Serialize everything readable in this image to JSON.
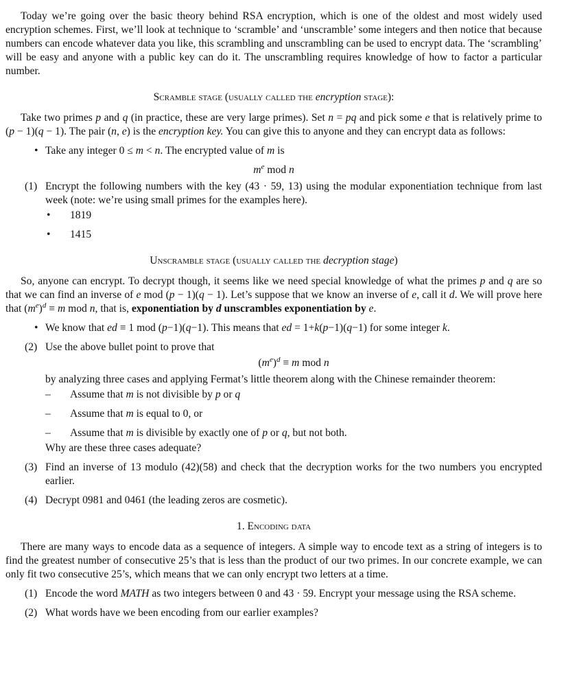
{
  "blocks": [
    {
      "type": "p",
      "segs": [
        {
          "t": "Today we’re going over the basic theory behind RSA encryption, which is one of the oldest and most widely used encryption schemes. First, we’ll look at technique to ‘scramble’ and ‘unscramble’ some integers and then notice that because numbers can encode whatever data you like, this scrambling and unscrambling can be used to encrypt data. The ‘scrambling’ will be easy and anyone with a public key can do it. The unscrambling requires knowledge of how to factor a particular number."
        }
      ]
    },
    {
      "type": "h",
      "segs": [
        {
          "t": "Scramble stage (usually called the ",
          "s": "sc"
        },
        {
          "t": "encryption",
          "s": "i"
        },
        {
          "t": " stage):",
          "s": "sc"
        }
      ]
    },
    {
      "type": "p",
      "segs": [
        {
          "t": "Take two primes "
        },
        {
          "t": "p",
          "s": "i"
        },
        {
          "t": " and "
        },
        {
          "t": "q",
          "s": "i"
        },
        {
          "t": " (in practice, these are very large primes). Set "
        },
        {
          "t": "n",
          "s": "i"
        },
        {
          "t": " = "
        },
        {
          "t": "pq",
          "s": "i"
        },
        {
          "t": " and pick some "
        },
        {
          "t": "e",
          "s": "i"
        },
        {
          "t": " that is relatively prime to ("
        },
        {
          "t": "p",
          "s": "i"
        },
        {
          "t": " − 1)("
        },
        {
          "t": "q",
          "s": "i"
        },
        {
          "t": " − 1). The pair ("
        },
        {
          "t": "n",
          "s": "i"
        },
        {
          "t": ", "
        },
        {
          "t": "e",
          "s": "i"
        },
        {
          "t": ") is the "
        },
        {
          "t": "encryption key.",
          "s": "i"
        },
        {
          "t": " You can give this to anyone and they can encrypt data as follows:"
        }
      ]
    },
    {
      "type": "list",
      "items": [
        {
          "label": "•",
          "kind": "bullet",
          "segs": [
            {
              "t": "Take any integer 0 ≤ "
            },
            {
              "t": "m",
              "s": "i"
            },
            {
              "t": " < "
            },
            {
              "t": "n",
              "s": "i"
            },
            {
              "t": ". The encrypted value of "
            },
            {
              "t": "m",
              "s": "i"
            },
            {
              "t": " is"
            }
          ]
        }
      ]
    },
    {
      "type": "display",
      "segs": [
        {
          "t": "m",
          "s": "i"
        },
        {
          "t": "e",
          "s": "sup"
        },
        {
          "t": "    mod "
        },
        {
          "t": "n",
          "s": "i"
        }
      ]
    },
    {
      "type": "list",
      "items": [
        {
          "label": "(1)",
          "kind": "enum",
          "segs": [
            {
              "t": "Encrypt the following numbers with the key (43 · 59, 13) using the modular exponentiation technique from last week (note: we’re using small primes for the examples here)."
            }
          ],
          "children": [
            {
              "label": "•",
              "kind": "bullet",
              "segs": [
                {
                  "t": "1819"
                }
              ]
            },
            {
              "label": "•",
              "kind": "bullet",
              "segs": [
                {
                  "t": "1415"
                }
              ]
            }
          ]
        }
      ]
    },
    {
      "type": "h",
      "segs": [
        {
          "t": "Unscramble stage (usually called the ",
          "s": "sc"
        },
        {
          "t": "decryption stage",
          "s": "i"
        },
        {
          "t": ")"
        }
      ]
    },
    {
      "type": "p",
      "segs": [
        {
          "t": "So, anyone can encrypt. To decrypt though, it seems like we need special knowledge of what the primes "
        },
        {
          "t": "p",
          "s": "i"
        },
        {
          "t": " and "
        },
        {
          "t": "q",
          "s": "i"
        },
        {
          "t": " are so that we can find an inverse of "
        },
        {
          "t": "e",
          "s": "i"
        },
        {
          "t": " mod ("
        },
        {
          "t": "p",
          "s": "i"
        },
        {
          "t": " − 1)("
        },
        {
          "t": "q",
          "s": "i"
        },
        {
          "t": " − 1). Let’s suppose that we know an inverse of "
        },
        {
          "t": "e",
          "s": "i"
        },
        {
          "t": ", call it "
        },
        {
          "t": "d",
          "s": "i"
        },
        {
          "t": ". We will prove here that ("
        },
        {
          "t": "m",
          "s": "i"
        },
        {
          "t": "e",
          "s": "sup"
        },
        {
          "t": ")"
        },
        {
          "t": "d",
          "s": "sup"
        },
        {
          "t": " ≡ "
        },
        {
          "t": "m",
          "s": "i"
        },
        {
          "t": "  mod "
        },
        {
          "t": "n",
          "s": "i"
        },
        {
          "t": ", that is, "
        },
        {
          "t": "exponentiation by ",
          "s": "b"
        },
        {
          "t": "d",
          "s": "bi"
        },
        {
          "t": " unscrambles exponentiation by ",
          "s": "b"
        },
        {
          "t": "e",
          "s": "i"
        },
        {
          "t": "."
        }
      ]
    },
    {
      "type": "list",
      "items": [
        {
          "label": "•",
          "kind": "bullet",
          "segs": [
            {
              "t": "We know that "
            },
            {
              "t": "ed",
              "s": "i"
            },
            {
              "t": " ≡ 1  mod ("
            },
            {
              "t": "p",
              "s": "i"
            },
            {
              "t": "−1)("
            },
            {
              "t": "q",
              "s": "i"
            },
            {
              "t": "−1). This means that "
            },
            {
              "t": "ed",
              "s": "i"
            },
            {
              "t": " = 1+"
            },
            {
              "t": "k",
              "s": "i"
            },
            {
              "t": "("
            },
            {
              "t": "p",
              "s": "i"
            },
            {
              "t": "−1)("
            },
            {
              "t": "q",
              "s": "i"
            },
            {
              "t": "−1) for some integer "
            },
            {
              "t": "k",
              "s": "i"
            },
            {
              "t": "."
            }
          ]
        }
      ]
    },
    {
      "type": "list",
      "items": [
        {
          "label": "(2)",
          "kind": "enum",
          "segs": [
            {
              "t": "Use the above bullet point to prove that"
            }
          ],
          "display": [
            {
              "t": "("
            },
            {
              "t": "m",
              "s": "i"
            },
            {
              "t": "e",
              "s": "sup"
            },
            {
              "t": ")"
            },
            {
              "t": "d",
              "s": "sup"
            },
            {
              "t": " ≡ "
            },
            {
              "t": "m",
              "s": "i"
            },
            {
              "t": "    mod "
            },
            {
              "t": "n",
              "s": "i"
            }
          ],
          "after": [
            {
              "t": "by analyzing three cases and applying Fermat’s little theorem along with the Chinese remainder theorem:"
            }
          ],
          "children": [
            {
              "label": "–",
              "kind": "dash",
              "segs": [
                {
                  "t": "Assume that "
                },
                {
                  "t": "m",
                  "s": "i"
                },
                {
                  "t": " is not divisible by "
                },
                {
                  "t": "p",
                  "s": "i"
                },
                {
                  "t": " or "
                },
                {
                  "t": "q",
                  "s": "i"
                }
              ]
            },
            {
              "label": "–",
              "kind": "dash",
              "segs": [
                {
                  "t": "Assume that "
                },
                {
                  "t": "m",
                  "s": "i"
                },
                {
                  "t": " is equal to 0, or"
                }
              ]
            },
            {
              "label": "–",
              "kind": "dash",
              "segs": [
                {
                  "t": "Assume that "
                },
                {
                  "t": "m",
                  "s": "i"
                },
                {
                  "t": " is divisible by exactly one of "
                },
                {
                  "t": "p",
                  "s": "i"
                },
                {
                  "t": " or "
                },
                {
                  "t": "q",
                  "s": "i"
                },
                {
                  "t": ", but not both."
                }
              ]
            }
          ],
          "tail": [
            {
              "t": "Why are these three cases adequate?"
            }
          ]
        },
        {
          "label": "(3)",
          "kind": "enum",
          "segs": [
            {
              "t": "Find an inverse of 13 modulo (42)(58) and check that the decryption works for the two numbers you encrypted earlier."
            }
          ]
        },
        {
          "label": "(4)",
          "kind": "enum",
          "segs": [
            {
              "t": "Decrypt 0981 and 0461 (the leading zeros are cosmetic)."
            }
          ]
        }
      ]
    },
    {
      "type": "h",
      "segs": [
        {
          "t": "1. "
        },
        {
          "t": "Encoding data",
          "s": "sc"
        }
      ]
    },
    {
      "type": "p",
      "segs": [
        {
          "t": "There are many ways to encode data as a sequence of integers. A simple way to encode text as a string of integers is to find the greatest number of consecutive 25’s that is less than the product of our two primes. In our concrete example, we can only fit two consecutive 25’s, which means that we can only encrypt two letters at a time."
        }
      ]
    },
    {
      "type": "list",
      "items": [
        {
          "label": "(1)",
          "kind": "enum",
          "segs": [
            {
              "t": "Encode the word "
            },
            {
              "t": "MATH",
              "s": "i"
            },
            {
              "t": " as two integers between 0 and 43 · 59. Encrypt your message using the RSA scheme."
            }
          ]
        },
        {
          "label": "(2)",
          "kind": "enum",
          "segs": [
            {
              "t": "What words have we been encoding from our earlier examples?"
            }
          ]
        }
      ]
    }
  ]
}
